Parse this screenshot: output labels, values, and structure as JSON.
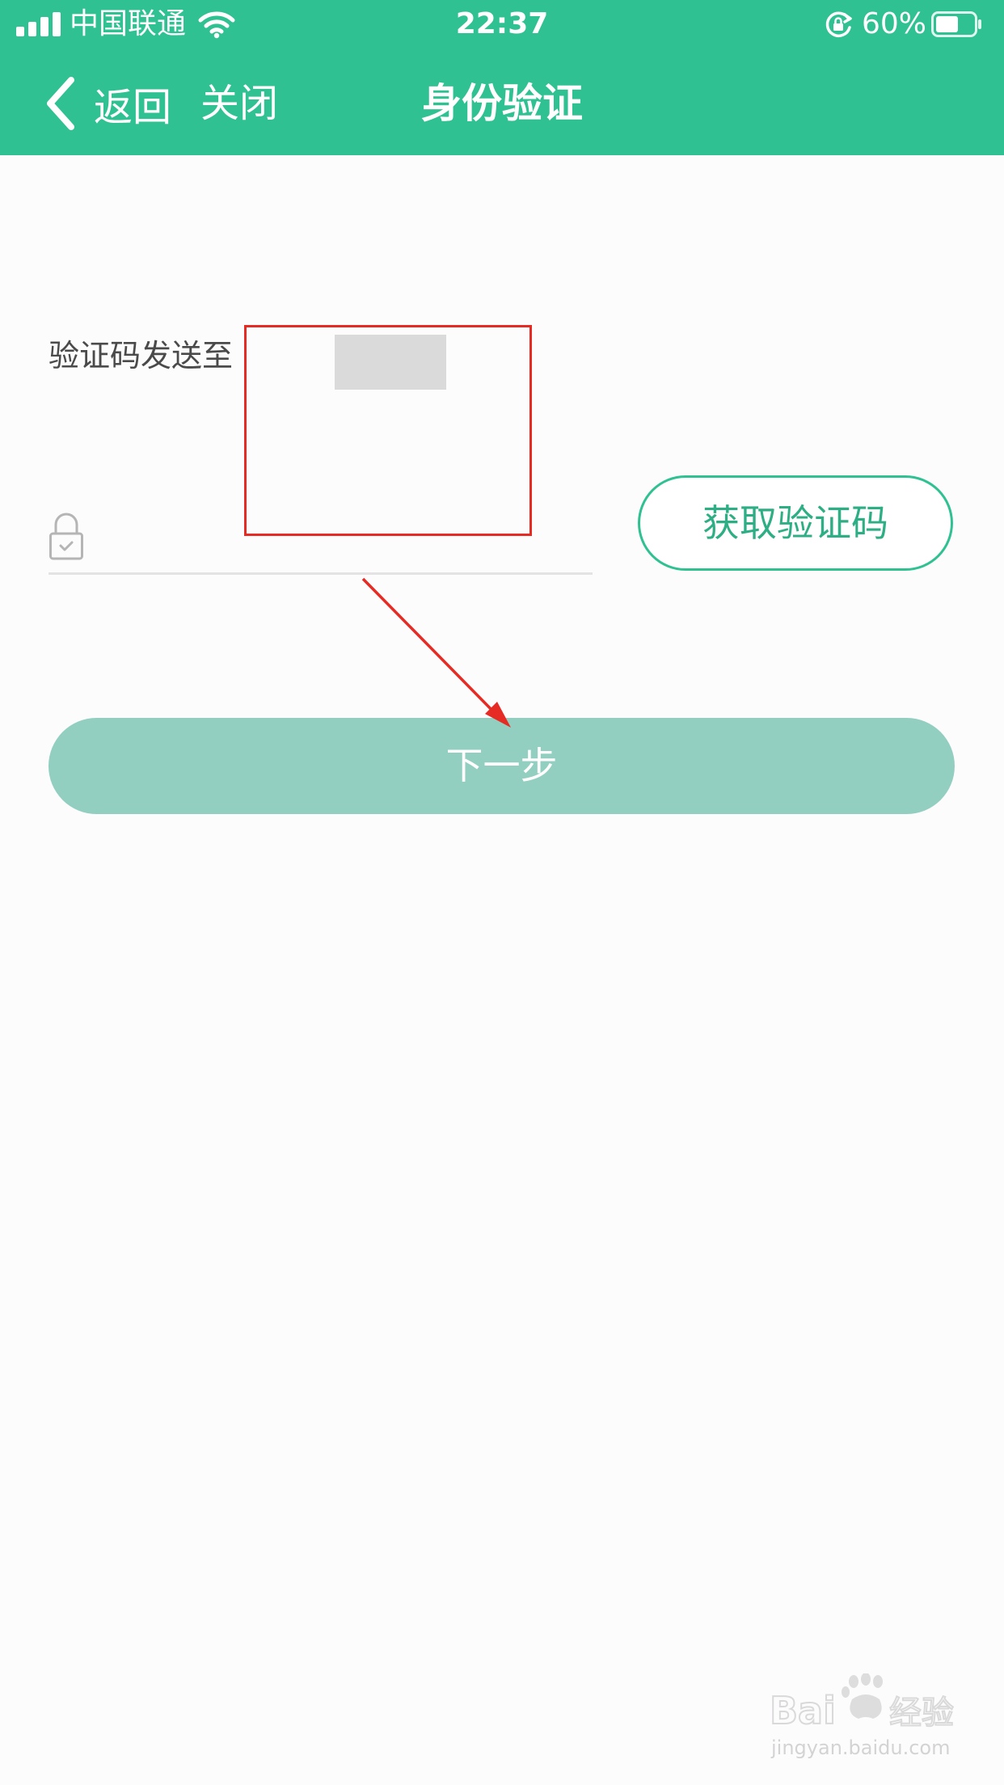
{
  "colors": {
    "accent": "#2fc192",
    "annotation": "#e52b24"
  },
  "status_bar": {
    "carrier": "中国联通",
    "time": "22:37",
    "battery_percent": "60%",
    "battery_level": 0.6,
    "icons": [
      "signal-icon",
      "wifi-icon",
      "rotation-lock-icon",
      "battery-icon"
    ]
  },
  "nav": {
    "back_label": "返回",
    "close_label": "关闭",
    "title": "身份验证",
    "back_icon": "chevron-left-icon"
  },
  "form": {
    "sent_to_label": "验证码发送至",
    "code_input": {
      "value": "",
      "placeholder": "",
      "icon": "lock-icon"
    },
    "get_code_label": "获取验证码",
    "next_label": "下一步"
  },
  "watermark": {
    "domain": "jingyan.baidu.com",
    "logo_text": "Baidu经验"
  }
}
